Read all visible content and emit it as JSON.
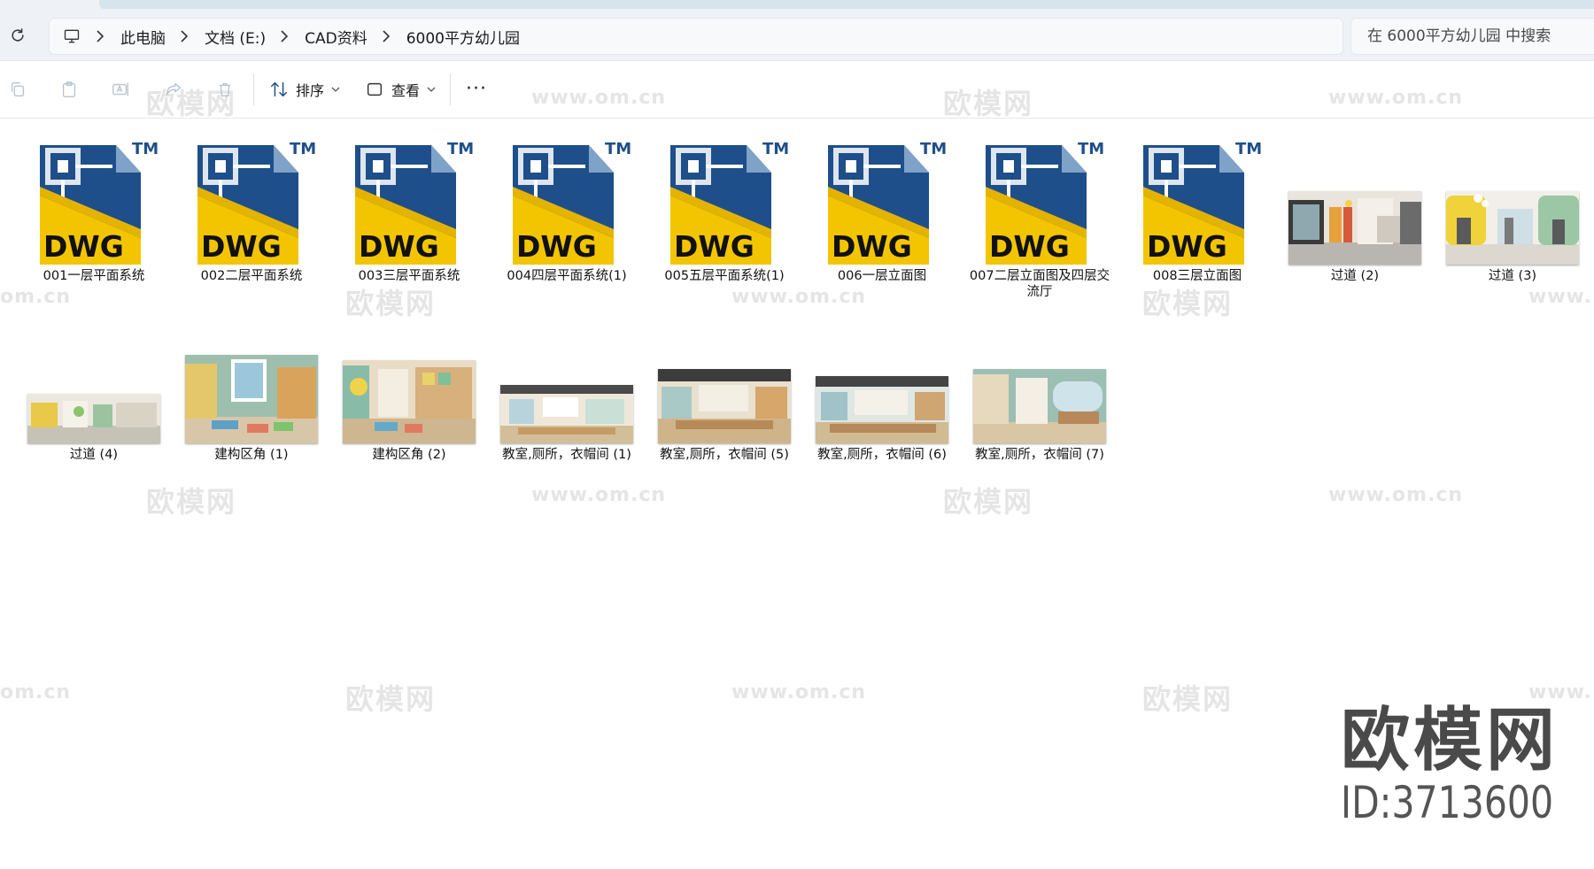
{
  "address": {
    "breadcrumbs": [
      "此电脑",
      "文档 (E:)",
      "CAD资料",
      "6000平方幼儿园"
    ]
  },
  "search": {
    "placeholder": "在 6000平方幼儿园 中搜索"
  },
  "toolbar": {
    "sort_label": "排序",
    "view_label": "查看",
    "more_label": "···"
  },
  "files": [
    {
      "name": "001一层平面系统",
      "type": "dwg"
    },
    {
      "name": "002二层平面系统",
      "type": "dwg"
    },
    {
      "name": "003三层平面系统",
      "type": "dwg"
    },
    {
      "name": "004四层平面系统(1)",
      "type": "dwg"
    },
    {
      "name": "005五层平面系统(1)",
      "type": "dwg"
    },
    {
      "name": "006一层立面图",
      "type": "dwg"
    },
    {
      "name": "007二层立面图及四层交流厅",
      "type": "dwg"
    },
    {
      "name": "008三层立面图",
      "type": "dwg"
    },
    {
      "name": "过道 (2)",
      "type": "image"
    },
    {
      "name": "过道 (3)",
      "type": "image"
    },
    {
      "name": "过道 (4)",
      "type": "image"
    },
    {
      "name": "建构区角 (1)",
      "type": "image"
    },
    {
      "name": "建构区角 (2)",
      "type": "image"
    },
    {
      "name": "教室,厕所，衣帽间 (1)",
      "type": "image"
    },
    {
      "name": "教室,厕所，衣帽间 (5)",
      "type": "image"
    },
    {
      "name": "教室,厕所，衣帽间 (6)",
      "type": "image"
    },
    {
      "name": "教室,厕所，衣帽间 (7)",
      "type": "image"
    }
  ],
  "dwg_icon": {
    "text": "DWG",
    "tm": "TM"
  },
  "watermark": {
    "cn": "欧模网",
    "url": "www.om.cn",
    "url_partial_left": "om.cn",
    "url_partial_right": "www."
  },
  "brand": {
    "name": "欧模网",
    "id": "ID:3713600"
  },
  "colors": {
    "dwg_blue": "#1f4f8a",
    "dwg_yellow": "#f2c500",
    "address_bg": "#eef2f6"
  }
}
